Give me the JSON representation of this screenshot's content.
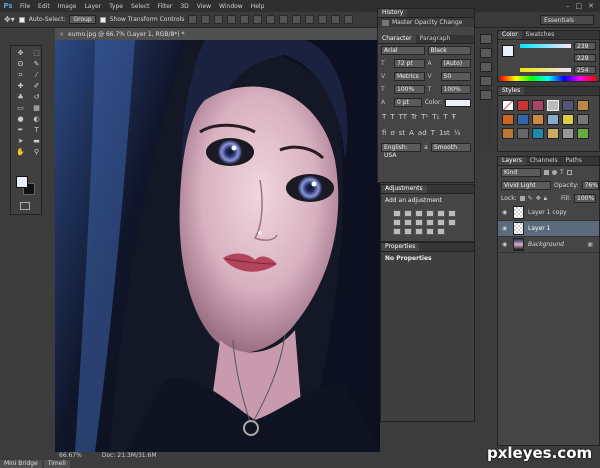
{
  "app": {
    "logo": "Ps"
  },
  "menu": [
    "File",
    "Edit",
    "Image",
    "Layer",
    "Type",
    "Select",
    "Filter",
    "3D",
    "View",
    "Window",
    "Help"
  ],
  "window_controls": [
    "–",
    "□",
    "✕"
  ],
  "options_bar": {
    "auto_select_label": "Auto-Select:",
    "auto_select_value": "Group",
    "transform_label": "Show Transform Controls",
    "workspace": "Essentials"
  },
  "document": {
    "tab_title": "eumo.jpg @ 66.7% (Layer 1, RGB/8*) *",
    "zoom": "66.67%",
    "doc_size": "Doc: 21.3M/31.6M"
  },
  "bottom_tabs": [
    "Mini Bridge",
    "Timeli"
  ],
  "history": {
    "tabs": [
      "History"
    ],
    "item": "Master Opacity Change"
  },
  "character": {
    "tabs": [
      "Character",
      "Paragraph"
    ],
    "font": "Arial",
    "style": "Black",
    "size": "72 pt",
    "leading": "(Auto)",
    "kerning": "Metrics",
    "tracking": "50",
    "vscale": "100%",
    "hscale": "100%",
    "baseline": "0 pt",
    "color_label": "Color:",
    "glyphs": [
      "T",
      "T",
      "TT",
      "Tr",
      "T¹",
      "T₁",
      "T",
      "Ŧ"
    ],
    "glyphs2": [
      "fi",
      "ơ",
      "st",
      "A",
      "ad",
      "T",
      "1st",
      "½"
    ],
    "language": "English: USA",
    "aa": "a",
    "aa_method": "Smooth"
  },
  "adjustments": {
    "title": "Adjustments",
    "subtitle": "Add an adjustment"
  },
  "properties": {
    "title": "Properties",
    "text": "No Properties"
  },
  "color_panel": {
    "tabs": [
      "Color",
      "Swatches"
    ],
    "r": "239",
    "g": "229",
    "b": "254"
  },
  "styles_panel": {
    "tabs": [
      "Styles"
    ]
  },
  "layers_panel": {
    "tabs": [
      "Layers",
      "Channels",
      "Paths"
    ],
    "kind": "Kind",
    "blend": "Vivid Light",
    "opacity_label": "Opacity:",
    "opacity": "76%",
    "lock_label": "Lock:",
    "fill_label": "Fill:",
    "fill": "100%",
    "layers": [
      {
        "name": "Layer 1 copy",
        "selected": false
      },
      {
        "name": "Layer 1",
        "selected": true
      },
      {
        "name": "Background",
        "selected": false
      }
    ]
  },
  "watermark": "pxleyes.com",
  "colors": {
    "accent_selection": "#5b6a7d",
    "foreground": "#e8f0fa",
    "background": "#111111"
  }
}
